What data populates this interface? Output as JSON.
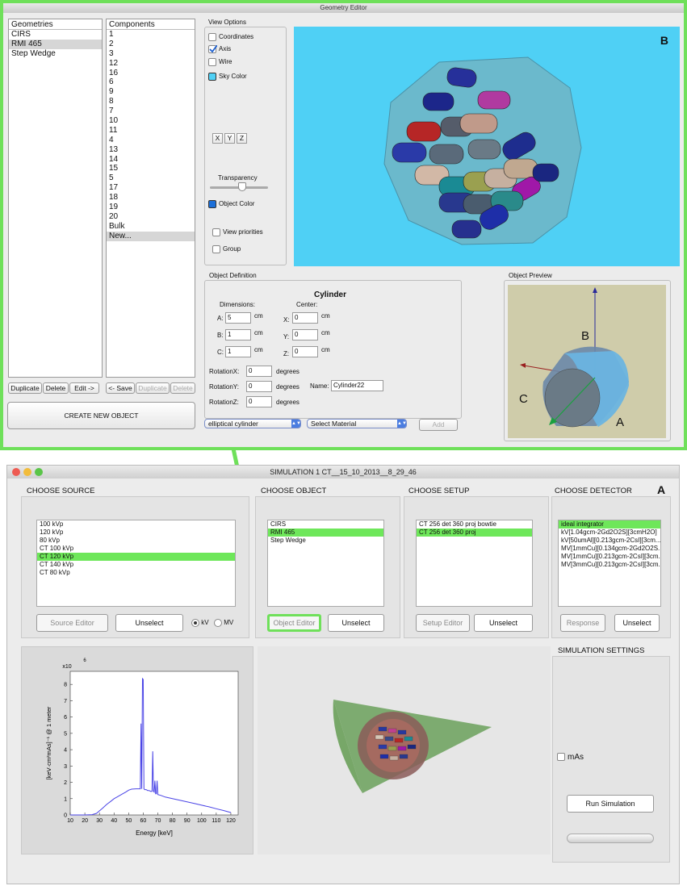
{
  "geometry_editor": {
    "title": "Geometry Editor",
    "panel_label": "B",
    "geometries": {
      "header": "Geometries",
      "items": [
        "CIRS",
        "RMI 465",
        "Step Wedge"
      ],
      "selected": "RMI 465"
    },
    "components": {
      "header": "Components",
      "items": [
        "1",
        "2",
        "3",
        "12",
        "16",
        "6",
        "9",
        "8",
        "7",
        "10",
        "11",
        "4",
        "13",
        "14",
        "15",
        "5",
        "17",
        "18",
        "19",
        "20",
        "Bulk",
        "New..."
      ],
      "selected": "New..."
    },
    "geometry_buttons": [
      "Duplicate",
      "Delete",
      "Edit ->"
    ],
    "component_buttons": [
      "<- Save",
      "Duplicate",
      "Delete"
    ],
    "create_button": "CREATE NEW OBJECT",
    "view_options": {
      "title": "View Options",
      "coordinates": "Coordinates",
      "axis": "Axis",
      "wire": "Wire",
      "sky_color": "Sky Color",
      "axis_buttons": [
        "X",
        "Y",
        "Z"
      ],
      "transparency": "Transparency",
      "transparency_value": 0.55,
      "object_color": "Object Color",
      "view_priorities": "View priorities",
      "group": "Group",
      "sky_color_hex": "#4fd0f5",
      "object_color_hex": "#1c6fd8"
    },
    "object_definition": {
      "title": "Object Definition",
      "shape": "Cylinder",
      "dimensions_label": "Dimensions:",
      "center_label": "Center:",
      "dims": [
        {
          "label": "A:",
          "value": "5",
          "unit": "cm"
        },
        {
          "label": "B:",
          "value": "1",
          "unit": "cm"
        },
        {
          "label": "C:",
          "value": "1",
          "unit": "cm"
        }
      ],
      "center": [
        {
          "label": "X:",
          "value": "0",
          "unit": "cm"
        },
        {
          "label": "Y:",
          "value": "0",
          "unit": "cm"
        },
        {
          "label": "Z:",
          "value": "0",
          "unit": "cm"
        }
      ],
      "rotations": [
        {
          "label": "RotationX:",
          "value": "0",
          "unit": "degrees"
        },
        {
          "label": "RotationY:",
          "value": "0",
          "unit": "degrees"
        },
        {
          "label": "RotationZ:",
          "value": "0",
          "unit": "degrees"
        }
      ],
      "name_label": "Name:",
      "name_value": "Cylinder22",
      "shape_select": "elliptical cylinder",
      "material_select": "Select Material",
      "add_button": "Add"
    },
    "object_preview": {
      "title": "Object Preview",
      "axis_labels": [
        "A",
        "B",
        "C"
      ]
    }
  },
  "simulation": {
    "title": "SIMULATION 1 CT__15_10_2013__8_29_46",
    "panel_label": "A",
    "source": {
      "title": "CHOOSE SOURCE",
      "items": [
        "100 kVp",
        "120 kVp",
        "80 kVp",
        "CT 100 kVp",
        "CT 120 kVp",
        "CT 140 kVp",
        "CT 80 kVp"
      ],
      "selected": "CT 120 kVp",
      "editor_button": "Source Editor",
      "unselect_button": "Unselect",
      "radio_kv": "kV",
      "radio_mv": "MV"
    },
    "object": {
      "title": "CHOOSE OBJECT",
      "items": [
        "CIRS",
        "RMI 465",
        "Step Wedge"
      ],
      "selected": "RMI 465",
      "editor_button": "Object Editor",
      "unselect_button": "Unselect"
    },
    "setup": {
      "title": "CHOOSE SETUP",
      "items": [
        "CT 256 det 360 proj bowtie",
        "CT 256 det 360 proj"
      ],
      "selected": "CT 256 det 360 proj",
      "editor_button": "Setup Editor",
      "unselect_button": "Unselect"
    },
    "detector": {
      "title": "CHOOSE DETECTOR",
      "items": [
        "ideal integrator",
        "kV[1.04gcm-2Gd2O2S][3cmH2O]",
        "kV[50umAl][0.213gcm-2CsI][3cm...",
        "MV[1mmCu][0.134gcm-2Gd2O2S...",
        "MV[1mmCu][0.213gcm-2CsI][3cm...",
        "MV[3mmCu][0.213gcm-2CsI][3cm..."
      ],
      "selected": "ideal integrator",
      "response_button": "Response",
      "unselect_button": "Unselect"
    },
    "settings": {
      "title": "SIMULATION SETTINGS",
      "mas_label": "mAs",
      "run_button": "Run Simulation"
    }
  },
  "chart_data": {
    "type": "line",
    "xlabel": "Energy [keV]",
    "ylabel": "[keV·cm²mAs]⁻¹ @ 1 meter",
    "y_multiplier": "x10",
    "y_exponent": "6",
    "xlim": [
      10,
      125
    ],
    "ylim": [
      0,
      8.8
    ],
    "x_ticks": [
      10,
      20,
      30,
      40,
      50,
      60,
      70,
      80,
      90,
      100,
      110,
      120
    ],
    "y_ticks": [
      0,
      1,
      2,
      3,
      4,
      5,
      6,
      7,
      8
    ],
    "series": [
      {
        "x": [
          10,
          20,
          25,
          28,
          30,
          32,
          35,
          38,
          40,
          42,
          45,
          48,
          50,
          52,
          55,
          57,
          58,
          58.5,
          59,
          59.5,
          60,
          60.5,
          61,
          62,
          63,
          64,
          65,
          66,
          66.5,
          67,
          67.5,
          68,
          68.5,
          69,
          69.5,
          70,
          72,
          75,
          80,
          85,
          90,
          95,
          100,
          105,
          110,
          115,
          120
        ],
        "y": [
          0,
          0,
          0.02,
          0.1,
          0.25,
          0.4,
          0.65,
          0.85,
          1.0,
          1.1,
          1.25,
          1.4,
          1.52,
          1.58,
          1.6,
          1.6,
          1.6,
          5.6,
          1.6,
          8.35,
          8.3,
          1.6,
          1.55,
          1.55,
          1.5,
          1.5,
          1.45,
          1.45,
          3.9,
          1.45,
          1.4,
          2.1,
          1.3,
          1.3,
          2.1,
          1.25,
          1.2,
          1.1,
          1.0,
          0.9,
          0.8,
          0.7,
          0.6,
          0.5,
          0.38,
          0.27,
          0.15
        ],
        "color": "#4a44e6"
      }
    ]
  }
}
